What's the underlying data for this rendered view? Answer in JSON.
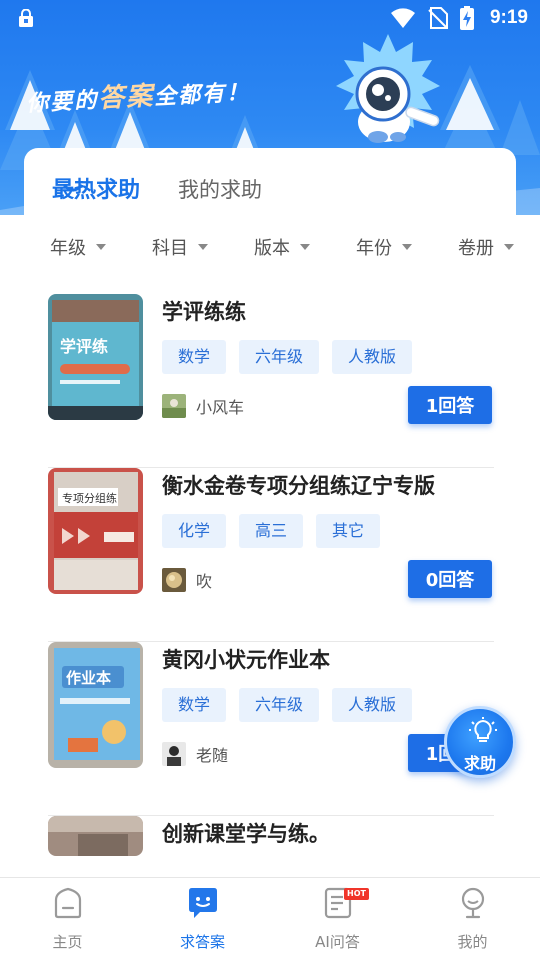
{
  "status_bar": {
    "time": "9:19"
  },
  "banner": {
    "slogan_pre": "你要的",
    "slogan_hl": "答案",
    "slogan_post": "全都有！"
  },
  "tabs": [
    {
      "label": "最热求助",
      "active": true
    },
    {
      "label": "我的求助",
      "active": false
    }
  ],
  "filters": [
    "年级",
    "科目",
    "版本",
    "年份",
    "卷册"
  ],
  "items": [
    {
      "title": "学评练练",
      "tags": [
        "数学",
        "六年级",
        "人教版"
      ],
      "user": "小风车",
      "answer": "1回答"
    },
    {
      "title": "衡水金卷专项分组练辽宁专版",
      "tags": [
        "化学",
        "高三",
        "其它"
      ],
      "user": "吹",
      "answer": "0回答"
    },
    {
      "title": "黄冈小状元作业本",
      "tags": [
        "数学",
        "六年级",
        "人教版"
      ],
      "user": "老随",
      "answer": "1回答"
    },
    {
      "title": "创新课堂学与练。",
      "tags": [],
      "user": "",
      "answer": ""
    }
  ],
  "fab": {
    "label": "求助"
  },
  "bottom_nav": [
    {
      "label": "主页",
      "icon": "home-icon"
    },
    {
      "label": "求答案",
      "icon": "answer-chat-icon",
      "active": true
    },
    {
      "label": "AI问答",
      "icon": "ai-doc-icon",
      "badge": "HOT"
    },
    {
      "label": "我的",
      "icon": "profile-icon"
    }
  ],
  "colors": {
    "primary": "#1e6ee6",
    "header_blue": "#2e89f3",
    "tag_bg": "#e9f2fd",
    "hot_red": "#f0352a"
  }
}
